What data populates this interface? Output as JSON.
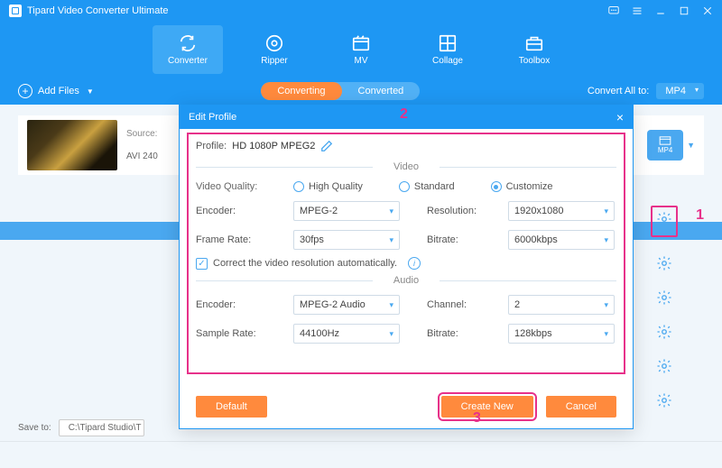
{
  "titlebar": {
    "app_name": "Tipard Video Converter Ultimate"
  },
  "main_tabs": {
    "converter": "Converter",
    "ripper": "Ripper",
    "mv": "MV",
    "collage": "Collage",
    "toolbox": "Toolbox"
  },
  "subbar": {
    "add_files": "Add Files",
    "converting": "Converting",
    "converted": "Converted",
    "convert_all_to": "Convert All to:",
    "convert_all_target": "MP4"
  },
  "file_row": {
    "source_label": "Source:",
    "meta": "AVI  240",
    "output_fmt": "MP4"
  },
  "save_to": {
    "label": "Save to:",
    "path": "C:\\Tipard Studio\\T"
  },
  "annotations": {
    "one": "1",
    "two": "2",
    "three": "3"
  },
  "modal": {
    "title": "Edit Profile",
    "profile_label": "Profile:",
    "profile_value": "HD 1080P MPEG2",
    "section_video": "Video",
    "section_audio": "Audio",
    "video_quality_label": "Video Quality:",
    "q_high": "High Quality",
    "q_standard": "Standard",
    "q_custom": "Customize",
    "v_encoder_label": "Encoder:",
    "v_encoder": "MPEG-2",
    "resolution_label": "Resolution:",
    "resolution": "1920x1080",
    "framerate_label": "Frame Rate:",
    "framerate": "30fps",
    "v_bitrate_label": "Bitrate:",
    "v_bitrate": "6000kbps",
    "auto_res": "Correct the video resolution automatically.",
    "a_encoder_label": "Encoder:",
    "a_encoder": "MPEG-2 Audio",
    "channel_label": "Channel:",
    "channel": "2",
    "samplerate_label": "Sample Rate:",
    "samplerate": "44100Hz",
    "a_bitrate_label": "Bitrate:",
    "a_bitrate": "128kbps",
    "btn_default": "Default",
    "btn_create": "Create New",
    "btn_cancel": "Cancel"
  }
}
